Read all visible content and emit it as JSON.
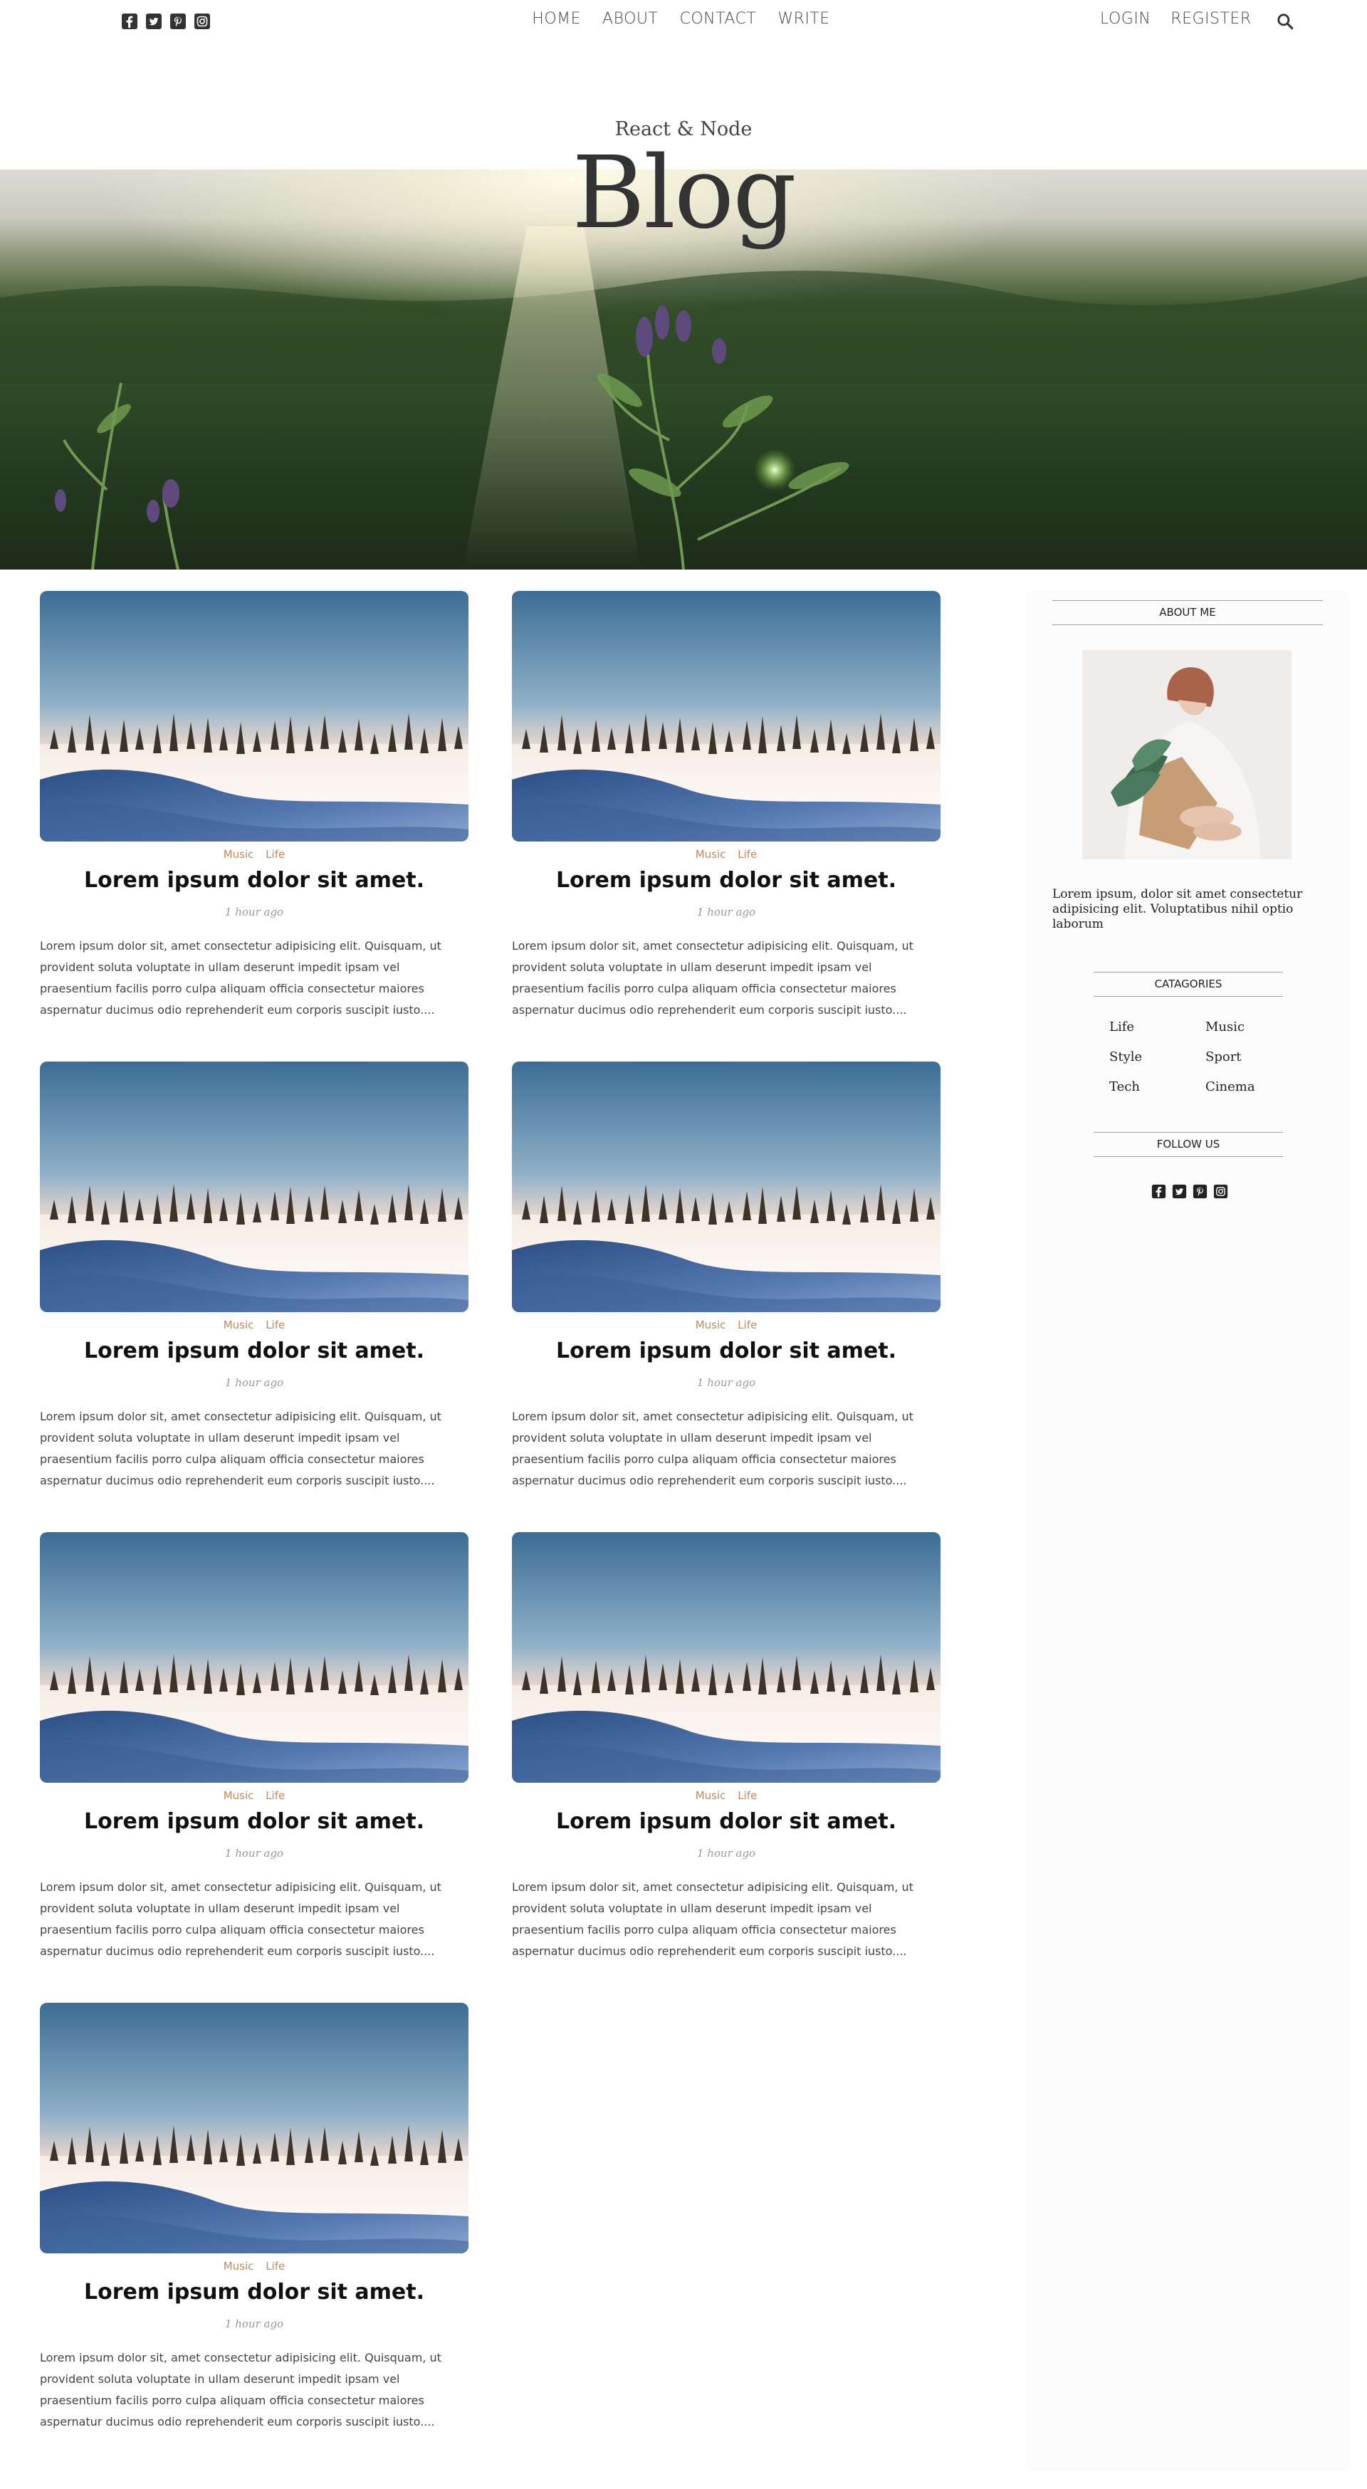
{
  "topbar": {
    "social_icons": [
      "facebook-square-icon",
      "twitter-square-icon",
      "pinterest-square-icon",
      "instagram-square-icon"
    ],
    "nav": [
      "HOME",
      "ABOUT",
      "CONTACT",
      "WRITE"
    ],
    "auth": [
      "LOGIN",
      "REGISTER"
    ],
    "search_icon": "search-icon"
  },
  "header": {
    "subtitle": "React & Node",
    "title": "Blog"
  },
  "posts": [
    {
      "categories": [
        "Music",
        "Life"
      ],
      "title": "Lorem ipsum dolor sit amet.",
      "date": "1 hour ago",
      "description": "Lorem ipsum dolor sit, amet consectetur adipisicing elit. Quisquam, ut provident soluta voluptate in ullam deserunt impedit ipsam vel praesentium facilis porro culpa aliquam officia consectetur maiores aspernatur ducimus odio reprehenderit eum corporis suscipit iusto...."
    },
    {
      "categories": [
        "Music",
        "Life"
      ],
      "title": "Lorem ipsum dolor sit amet.",
      "date": "1 hour ago",
      "description": "Lorem ipsum dolor sit, amet consectetur adipisicing elit. Quisquam, ut provident soluta voluptate in ullam deserunt impedit ipsam vel praesentium facilis porro culpa aliquam officia consectetur maiores aspernatur ducimus odio reprehenderit eum corporis suscipit iusto...."
    },
    {
      "categories": [
        "Music",
        "Life"
      ],
      "title": "Lorem ipsum dolor sit amet.",
      "date": "1 hour ago",
      "description": "Lorem ipsum dolor sit, amet consectetur adipisicing elit. Quisquam, ut provident soluta voluptate in ullam deserunt impedit ipsam vel praesentium facilis porro culpa aliquam officia consectetur maiores aspernatur ducimus odio reprehenderit eum corporis suscipit iusto...."
    },
    {
      "categories": [
        "Music",
        "Life"
      ],
      "title": "Lorem ipsum dolor sit amet.",
      "date": "1 hour ago",
      "description": "Lorem ipsum dolor sit, amet consectetur adipisicing elit. Quisquam, ut provident soluta voluptate in ullam deserunt impedit ipsam vel praesentium facilis porro culpa aliquam officia consectetur maiores aspernatur ducimus odio reprehenderit eum corporis suscipit iusto...."
    },
    {
      "categories": [
        "Music",
        "Life"
      ],
      "title": "Lorem ipsum dolor sit amet.",
      "date": "1 hour ago",
      "description": "Lorem ipsum dolor sit, amet consectetur adipisicing elit. Quisquam, ut provident soluta voluptate in ullam deserunt impedit ipsam vel praesentium facilis porro culpa aliquam officia consectetur maiores aspernatur ducimus odio reprehenderit eum corporis suscipit iusto...."
    },
    {
      "categories": [
        "Music",
        "Life"
      ],
      "title": "Lorem ipsum dolor sit amet.",
      "date": "1 hour ago",
      "description": "Lorem ipsum dolor sit, amet consectetur adipisicing elit. Quisquam, ut provident soluta voluptate in ullam deserunt impedit ipsam vel praesentium facilis porro culpa aliquam officia consectetur maiores aspernatur ducimus odio reprehenderit eum corporis suscipit iusto...."
    },
    {
      "categories": [
        "Music",
        "Life"
      ],
      "title": "Lorem ipsum dolor sit amet.",
      "date": "1 hour ago",
      "description": "Lorem ipsum dolor sit, amet consectetur adipisicing elit. Quisquam, ut provident soluta voluptate in ullam deserunt impedit ipsam vel praesentium facilis porro culpa aliquam officia consectetur maiores aspernatur ducimus odio reprehenderit eum corporis suscipit iusto...."
    }
  ],
  "sidebar": {
    "about_heading": "ABOUT ME",
    "about_text": "Lorem ipsum, dolor sit amet consectetur adipisicing elit. Voluptatibus nihil optio laborum",
    "categories_heading": "CATAGORIES",
    "categories": [
      "Life",
      "Music",
      "Style",
      "Sport",
      "Tech",
      "Cinema"
    ],
    "follow_heading": "FOLLOW US",
    "follow_icons": [
      "facebook-square-icon",
      "twitter-square-icon",
      "pinterest-square-icon",
      "instagram-square-icon"
    ]
  },
  "colors": {
    "category_accent": "#c08a5f",
    "text_dark": "#111111",
    "muted": "#999999",
    "sidebar_bg": "#fbfbfb"
  }
}
